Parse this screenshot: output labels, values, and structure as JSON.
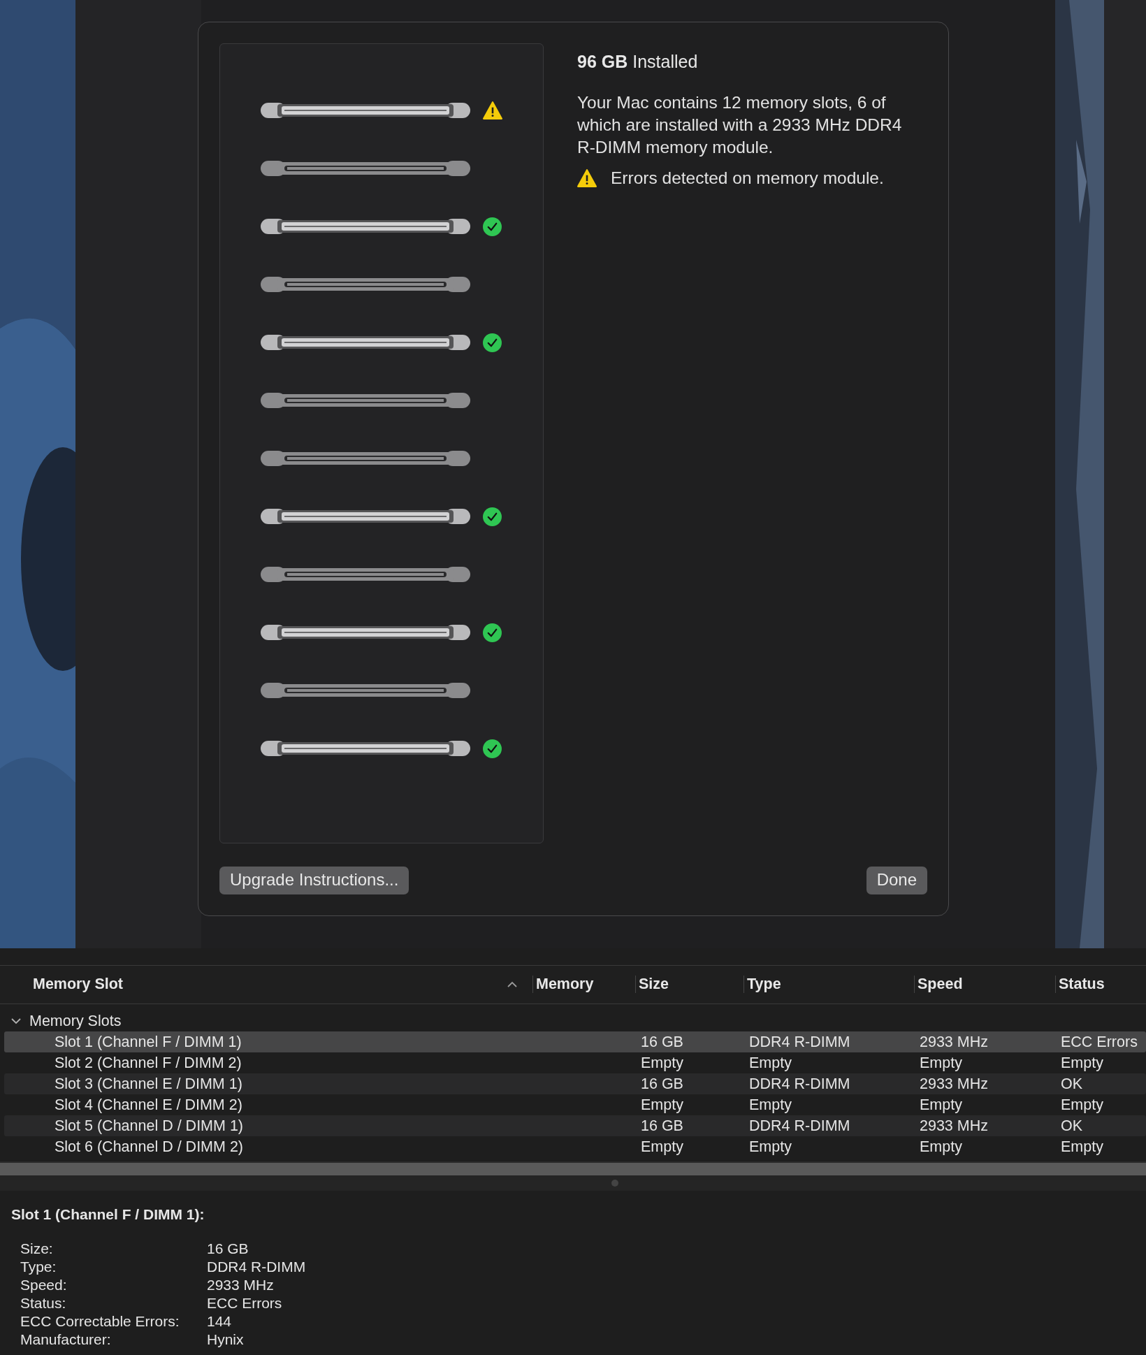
{
  "dialog": {
    "heading": "**96 GB** Installed",
    "description": "Your Mac contains 12 memory slots, 6 of which are installed with a 2933 MHz DDR4 R-DIMM memory module.",
    "alert": "Errors detected on memory module.",
    "slots": [
      {
        "kind": "warning"
      },
      {
        "kind": "empty"
      },
      {
        "kind": "ok"
      },
      {
        "kind": "empty"
      },
      {
        "kind": "ok"
      },
      {
        "kind": "empty"
      },
      {
        "kind": "empty"
      },
      {
        "kind": "ok"
      },
      {
        "kind": "empty"
      },
      {
        "kind": "ok"
      },
      {
        "kind": "empty"
      },
      {
        "kind": "ok"
      }
    ],
    "buttons": [
      "Upgrade Instructions...",
      "Done"
    ]
  },
  "table": {
    "columns": [
      "Memory Slot",
      "Memory",
      "Size",
      "Type",
      "Speed",
      "Status"
    ],
    "group": {
      "label": "Memory Slots",
      "expanded": true
    },
    "rows": [
      {
        "cells": [
          "Slot 1 (Channel F / DIMM 1)",
          "",
          "16 GB",
          "DDR4 R-DIMM",
          "2933 MHz",
          "ECC Errors"
        ],
        "selected": true
      },
      {
        "cells": [
          "Slot 2 (Channel F / DIMM 2)",
          "",
          "Empty",
          "Empty",
          "Empty",
          "Empty"
        ],
        "selected": false
      },
      {
        "cells": [
          "Slot 3 (Channel E / DIMM 1)",
          "",
          "16 GB",
          "DDR4 R-DIMM",
          "2933 MHz",
          "OK"
        ],
        "selected": false
      },
      {
        "cells": [
          "Slot 4 (Channel E / DIMM 2)",
          "",
          "Empty",
          "Empty",
          "Empty",
          "Empty"
        ],
        "selected": false
      },
      {
        "cells": [
          "Slot 5 (Channel D / DIMM 1)",
          "",
          "16 GB",
          "DDR4 R-DIMM",
          "2933 MHz",
          "OK"
        ],
        "selected": false
      },
      {
        "cells": [
          "Slot 6 (Channel D / DIMM 2)",
          "",
          "Empty",
          "Empty",
          "Empty",
          "Empty"
        ],
        "selected": false
      }
    ]
  },
  "details": {
    "title": "Slot 1 (Channel F / DIMM 1):",
    "fields": [
      {
        "label": "Size:",
        "value": "16 GB"
      },
      {
        "label": "Type:",
        "value": "DDR4 R-DIMM"
      },
      {
        "label": "Speed:",
        "value": "2933 MHz"
      },
      {
        "label": "Status:",
        "value": "ECC Errors"
      },
      {
        "label": "ECC Correctable Errors:",
        "value": "144"
      },
      {
        "label": "Manufacturer:",
        "value": "Hynix"
      }
    ]
  }
}
